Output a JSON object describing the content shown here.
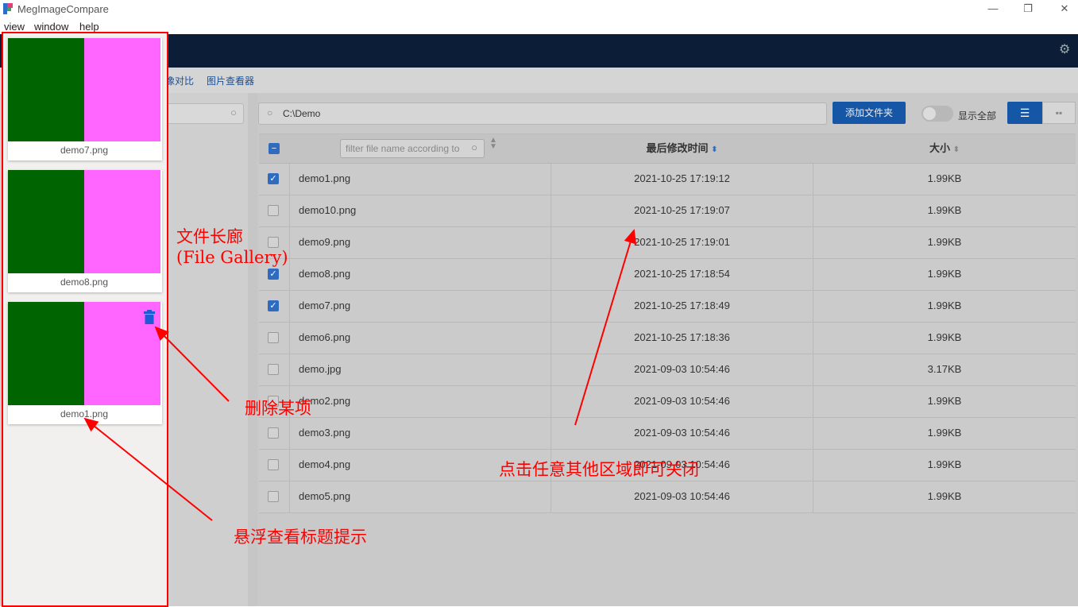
{
  "app": {
    "title": "MegImageCompare",
    "minimize": "—",
    "restore": "❐",
    "close": "✕"
  },
  "menu": [
    "view",
    "window",
    "help"
  ],
  "nav": {
    "links": [
      "像对比",
      "图片查看器"
    ]
  },
  "toolbar": {
    "path": "C:\\Demo",
    "add_folder": "添加文件夹",
    "show_all": "显示全部"
  },
  "table": {
    "filter_placeholder": "filter file name according to",
    "col_modified": "最后修改时间",
    "col_size": "大小",
    "rows": [
      {
        "name": "demo1.png",
        "modified": "2021-10-25 17:19:12",
        "size": "1.99KB",
        "checked": true
      },
      {
        "name": "demo10.png",
        "modified": "2021-10-25 17:19:07",
        "size": "1.99KB",
        "checked": false
      },
      {
        "name": "demo9.png",
        "modified": "2021-10-25 17:19:01",
        "size": "1.99KB",
        "checked": false
      },
      {
        "name": "demo8.png",
        "modified": "2021-10-25 17:18:54",
        "size": "1.99KB",
        "checked": true
      },
      {
        "name": "demo7.png",
        "modified": "2021-10-25 17:18:49",
        "size": "1.99KB",
        "checked": true
      },
      {
        "name": "demo6.png",
        "modified": "2021-10-25 17:18:36",
        "size": "1.99KB",
        "checked": false
      },
      {
        "name": "demo.jpg",
        "modified": "2021-09-03 10:54:46",
        "size": "3.17KB",
        "checked": false
      },
      {
        "name": "demo2.png",
        "modified": "2021-09-03 10:54:46",
        "size": "1.99KB",
        "checked": false
      },
      {
        "name": "demo3.png",
        "modified": "2021-09-03 10:54:46",
        "size": "1.99KB",
        "checked": false
      },
      {
        "name": "demo4.png",
        "modified": "2021-09-03 10:54:46",
        "size": "1.99KB",
        "checked": false
      },
      {
        "name": "demo5.png",
        "modified": "2021-09-03 10:54:46",
        "size": "1.99KB",
        "checked": false
      }
    ]
  },
  "gallery": {
    "items": [
      {
        "label": "demo7.png"
      },
      {
        "label": "demo8.png"
      },
      {
        "label": "demo1.png"
      }
    ]
  },
  "annotations": {
    "gallery_cn": "文件长廊",
    "gallery_en": "(File Gallery)",
    "delete": "删除某项",
    "hover": "悬浮查看标题提示",
    "close": "点击任意其他区域即可关闭"
  },
  "colors": {
    "accent": "#1556a6",
    "header": "#0c1d37",
    "annotation": "#ff0000",
    "thumb_left": "#006400",
    "thumb_right": "#ff66ff"
  }
}
